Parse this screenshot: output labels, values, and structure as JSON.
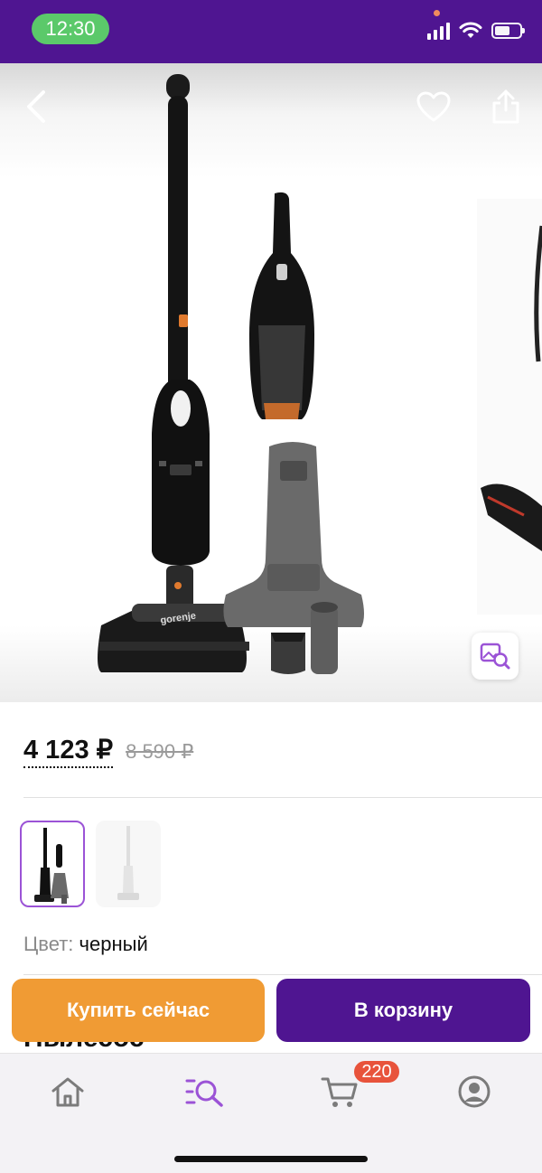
{
  "status_bar": {
    "time": "12:30"
  },
  "product": {
    "title_partial": "Пылесос",
    "price": {
      "current": "4 123 ₽",
      "old": "8 590 ₽"
    },
    "color": {
      "label": "Цвет:",
      "value": "черный"
    },
    "variants": [
      {
        "name": "black",
        "selected": true
      },
      {
        "name": "white",
        "selected": false
      }
    ],
    "brand_on_image": "gorenje"
  },
  "actions": {
    "buy_now": "Купить сейчас",
    "add_to_cart": "В корзину"
  },
  "tab_bar": {
    "items": [
      {
        "name": "home",
        "icon": "home-icon",
        "active": false
      },
      {
        "name": "catalog",
        "icon": "catalog-search-icon",
        "active": true
      },
      {
        "name": "cart",
        "icon": "cart-icon",
        "active": false,
        "badge": "220"
      },
      {
        "name": "profile",
        "icon": "profile-icon",
        "active": false
      }
    ]
  },
  "colors": {
    "brand_purple": "#4f1591",
    "accent_orange": "#f09b34",
    "badge_red": "#e8533b",
    "active_tab": "#9b53d6",
    "inactive_tab": "#7b7b7b"
  }
}
